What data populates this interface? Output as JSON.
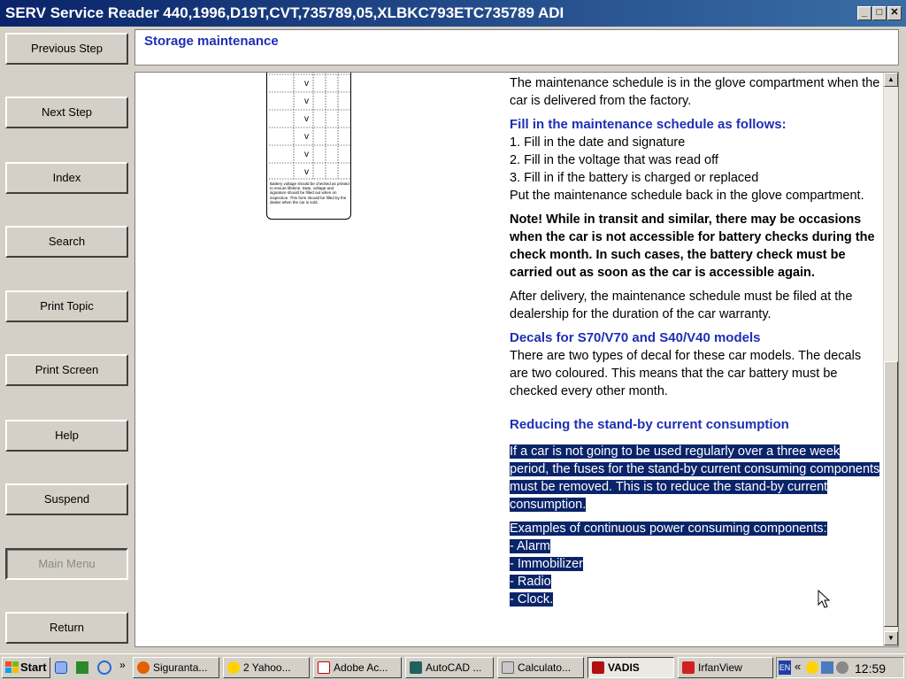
{
  "window": {
    "title": "SERV Service Reader 440,1996,D19T,CVT,735789,05,XLBKC793ETC735789 ADI",
    "min": "_",
    "max": "□",
    "close": "✕"
  },
  "nav": {
    "previous": "Previous Step",
    "next": "Next Step",
    "index": "Index",
    "search": "Search",
    "print_topic": "Print Topic",
    "print_screen": "Print Screen",
    "help": "Help",
    "suspend": "Suspend",
    "main_menu": "Main Menu",
    "return": "Return"
  },
  "header": {
    "title": "Storage maintenance"
  },
  "content": {
    "p1": "The maintenance schedule is in the glove compartment when the car is delivered from the factory.",
    "h1": "Fill in the maintenance schedule as follows:",
    "steps": [
      "1. Fill in the date and signature",
      "2. Fill in the voltage that was read off",
      "3. Fill in if the battery is charged or replaced"
    ],
    "p2": "Put the maintenance schedule back in the glove compartment.",
    "note": "Note! While in transit and similar, there may be occasions when the car is not accessible for battery checks during the check month. In such cases, the battery check must be carried out as soon as the car is accessible again.",
    "p3": "After delivery, the maintenance schedule must be filed at the dealership for the duration of the car warranty.",
    "h2": "Decals for S70/V70 and S40/V40 models",
    "p4": "There are two types of decal for these car models. The decals are two coloured. This means that the car battery must be checked every other month.",
    "h3": "Reducing the stand-by current consumption",
    "p5": "If a car is not going to be used regularly over a three week period, the fuses for the stand-by current consuming components must be removed. This is to reduce the stand-by current consumption.",
    "p6": "Examples of continuous power consuming components:",
    "components": [
      "-  Alarm",
      "-  Immobilizer",
      "-  Radio",
      "-  Clock."
    ],
    "decal_check": "v",
    "decal_fine": "Battery voltage should be checked as printed to ensure lifetime. Date, voltage and signature should be filled out when on inspection. This form should be filled by the dealer when the car is sold."
  },
  "taskbar": {
    "start": "Start",
    "tasks": [
      "Siguranta...",
      "2 Yahoo...",
      "Adobe Ac...",
      "AutoCAD ...",
      "Calculato...",
      "VADIS",
      "IrfanView"
    ],
    "lang": "EN",
    "time": "12:59"
  }
}
